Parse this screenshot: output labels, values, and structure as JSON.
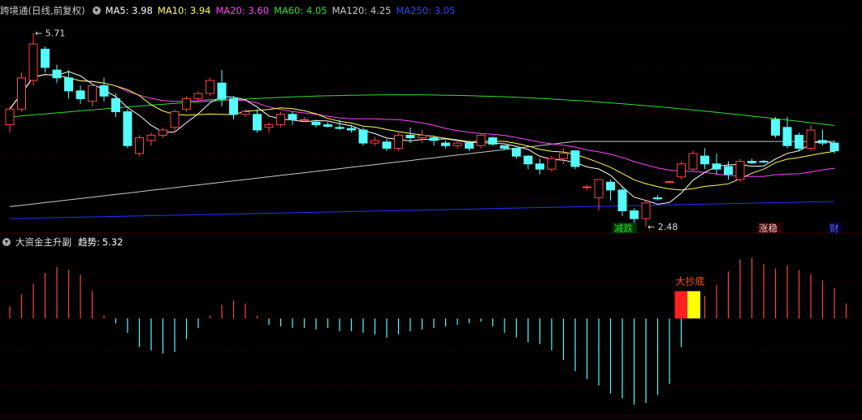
{
  "colors": {
    "background": "#000000",
    "up": "#ff4444",
    "down": "#54fcfc",
    "ma5": "#ffffff",
    "ma10": "#ffff55",
    "ma20": "#ff44ff",
    "ma60": "#33dd33",
    "ma120": "#c8c8c8",
    "ma250": "#2233ff",
    "label_green": "#33dd33",
    "label_red": "#ff4444",
    "label_blue": "#6666ff",
    "sub_title": "#ffffff",
    "sub_value": "#ffffff",
    "gridline": "#8b0000"
  },
  "main_header": {
    "title": "跨境通",
    "period": "(日线,前复权)",
    "ma5": "MA5: 3.98",
    "ma10": "MA10: 3.94",
    "ma20": "MA20: 3.60",
    "ma60": "MA60: 4.05",
    "ma120": "MA120: 4.25",
    "ma250": "MA250: 3.05"
  },
  "sub_header": {
    "title": "大资金主升副",
    "label": "趋势:",
    "value": "5.32"
  },
  "chart_data": [
    {
      "type": "candlestick",
      "annotations": {
        "high": "5.71",
        "low": "2.48",
        "signals": [
          "减跌",
          "涨稳",
          "财"
        ]
      },
      "ohlc": [
        [
          3.95,
          4.3,
          3.8,
          4.25
        ],
        [
          4.25,
          4.95,
          4.2,
          4.85
        ],
        [
          4.8,
          5.71,
          4.7,
          5.5
        ],
        [
          5.4,
          5.45,
          4.95,
          5.05
        ],
        [
          5.0,
          5.1,
          4.75,
          4.85
        ],
        [
          4.85,
          5.0,
          4.45,
          4.6
        ],
        [
          4.6,
          4.7,
          4.35,
          4.45
        ],
        [
          4.4,
          4.75,
          4.3,
          4.7
        ],
        [
          4.7,
          4.85,
          4.4,
          4.5
        ],
        [
          4.45,
          4.55,
          4.1,
          4.2
        ],
        [
          4.2,
          4.25,
          3.5,
          3.55
        ],
        [
          3.4,
          3.75,
          3.35,
          3.7
        ],
        [
          3.65,
          3.8,
          3.55,
          3.75
        ],
        [
          3.75,
          3.9,
          3.7,
          3.85
        ],
        [
          3.9,
          4.25,
          3.8,
          4.2
        ],
        [
          4.25,
          4.5,
          4.2,
          4.45
        ],
        [
          4.45,
          4.6,
          4.4,
          4.55
        ],
        [
          4.55,
          4.85,
          4.5,
          4.8
        ],
        [
          4.75,
          5.0,
          4.3,
          4.45
        ],
        [
          4.45,
          4.5,
          4.05,
          4.15
        ],
        [
          4.15,
          4.25,
          4.1,
          4.2
        ],
        [
          4.15,
          4.25,
          3.8,
          3.85
        ],
        [
          3.9,
          4.0,
          3.8,
          3.95
        ],
        [
          3.95,
          4.2,
          3.9,
          4.15
        ],
        [
          4.15,
          4.2,
          3.95,
          4.05
        ],
        [
          4.05,
          4.1,
          4.0,
          4.05
        ],
        [
          4.0,
          4.05,
          3.9,
          3.95
        ],
        [
          3.95,
          4.0,
          3.9,
          3.92
        ],
        [
          3.9,
          4.05,
          3.85,
          3.88
        ],
        [
          3.88,
          3.95,
          3.8,
          3.85
        ],
        [
          3.85,
          3.9,
          3.55,
          3.6
        ],
        [
          3.6,
          3.72,
          3.55,
          3.65
        ],
        [
          3.62,
          3.68,
          3.45,
          3.5
        ],
        [
          3.5,
          3.8,
          3.45,
          3.75
        ],
        [
          3.75,
          3.9,
          3.6,
          3.7
        ],
        [
          3.7,
          3.85,
          3.6,
          3.75
        ],
        [
          3.7,
          3.75,
          3.55,
          3.65
        ],
        [
          3.6,
          3.65,
          3.5,
          3.55
        ],
        [
          3.55,
          3.65,
          3.5,
          3.6
        ],
        [
          3.6,
          3.65,
          3.45,
          3.5
        ],
        [
          3.55,
          3.78,
          3.5,
          3.75
        ],
        [
          3.7,
          3.72,
          3.55,
          3.58
        ],
        [
          3.55,
          3.56,
          3.48,
          3.5
        ],
        [
          3.5,
          3.52,
          3.3,
          3.35
        ],
        [
          3.35,
          3.37,
          3.1,
          3.2
        ],
        [
          3.2,
          3.3,
          3.0,
          3.1
        ],
        [
          3.1,
          3.35,
          3.05,
          3.3
        ],
        [
          3.3,
          3.5,
          3.2,
          3.4
        ],
        [
          3.45,
          3.46,
          3.1,
          3.15
        ],
        [
          2.75,
          2.8,
          2.7,
          2.76
        ],
        [
          2.55,
          2.9,
          2.3,
          2.9
        ],
        [
          2.85,
          2.9,
          2.5,
          2.7
        ],
        [
          2.7,
          2.75,
          2.2,
          2.3
        ],
        [
          2.3,
          2.35,
          2.05,
          2.15
        ],
        [
          2.15,
          2.5,
          2.0,
          2.45
        ],
        [
          2.55,
          2.6,
          2.5,
          2.53
        ],
        [
          2.85,
          2.88,
          2.85,
          2.86
        ],
        [
          2.95,
          3.25,
          2.9,
          3.2
        ],
        [
          3.1,
          3.45,
          3.05,
          3.4
        ],
        [
          3.35,
          3.5,
          3.1,
          3.2
        ],
        [
          3.2,
          3.4,
          3.0,
          3.1
        ],
        [
          3.15,
          3.25,
          2.9,
          3.0
        ],
        [
          2.9,
          3.3,
          2.85,
          3.25
        ],
        [
          3.25,
          3.3,
          3.2,
          3.22
        ],
        [
          3.25,
          3.28,
          3.22,
          3.24
        ],
        [
          4.05,
          4.1,
          3.7,
          3.75
        ],
        [
          3.9,
          4.1,
          3.5,
          3.55
        ],
        [
          3.75,
          3.8,
          3.45,
          3.5
        ],
        [
          3.5,
          3.95,
          3.45,
          3.85
        ],
        [
          3.65,
          3.85,
          3.55,
          3.6
        ],
        [
          3.6,
          3.65,
          3.4,
          3.45
        ]
      ],
      "ylim": [
        1.95,
        6.0
      ]
    },
    {
      "type": "bar",
      "title": "大资金主升副",
      "annotation": "大抄底",
      "values": [
        0.8,
        1.6,
        2.3,
        3.0,
        3.4,
        3.2,
        2.9,
        1.8,
        0.2,
        -0.3,
        -0.9,
        -1.8,
        -2.0,
        -2.2,
        -2.1,
        -1.3,
        -0.6,
        0.2,
        0.9,
        1.2,
        1.0,
        0.2,
        -0.4,
        -0.5,
        -0.6,
        -0.6,
        -0.7,
        -0.6,
        -0.8,
        -0.8,
        -0.9,
        -1.0,
        -1.2,
        -1.0,
        -0.8,
        -0.7,
        -0.6,
        -0.5,
        -0.4,
        -0.3,
        -0.2,
        -0.5,
        -0.9,
        -1.2,
        -1.5,
        -1.6,
        -2.0,
        -2.6,
        -3.3,
        -3.8,
        -4.2,
        -4.7,
        -5.0,
        -5.4,
        -5.3,
        -4.8,
        -4.1,
        -1.8,
        0.8,
        1.5,
        2.2,
        3.1,
        3.9,
        4.0,
        3.6,
        3.3,
        3.5,
        3.2,
        2.9,
        2.5,
        2.0,
        1.0
      ],
      "signal_bars": {
        "red_index": 57,
        "yellow_index": 58,
        "height": 1.8
      },
      "ylim": [
        -5.8,
        4.5
      ]
    }
  ]
}
